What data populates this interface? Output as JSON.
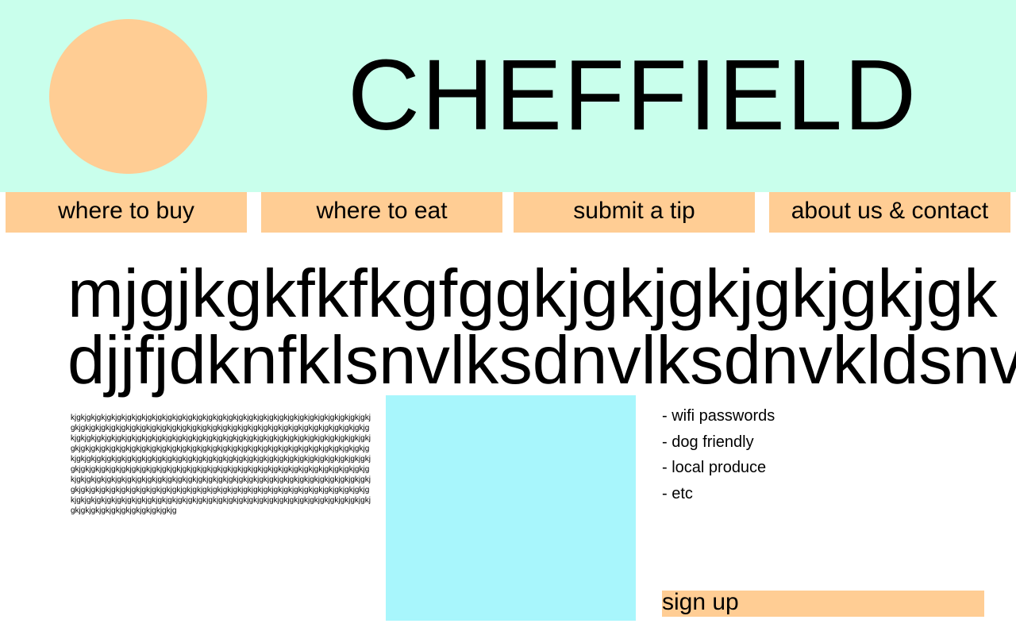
{
  "colors": {
    "header_bg": "#c9ffec",
    "accent": "#ffcd94",
    "image_placeholder": "#a8f6fc",
    "text": "#000000"
  },
  "header": {
    "title": "CHEFFIELD"
  },
  "nav": [
    {
      "label": "where to buy"
    },
    {
      "label": "where to eat"
    },
    {
      "label": "submit a tip"
    },
    {
      "label": "about us & contact"
    }
  ],
  "main": {
    "headline_line1": "mjgjkgkfkfkgfggkjgkjgkjgkjgkjgk",
    "headline_line2": "djjfjdknfklsnvlksdnvlksdnvkldsnv",
    "body_text": "kjgkjgkjgkjgkjgkjgkjgkjgkjgkjgkjgkjgkjgkjgkjgkjgkjgkjgkjgkjgkjgkjgkjgkjgkjgkjgkjgkjgkjgkjgkjgkjgkjgkjgkjgkjgkjgkjgkjgkjgkjgkjgkjgkjgkjgkjgkjgkjgkjgkjgkjgkjgkjgkjgkjgkjgkjgkjgkjgkjgkjgkjgkjgkjgkjgkjgkjgkjgkjgkjgkjgkjgkjgkjgkjgkjgkjgkjgkjgkjgkjgkjgkjgkjgkjgkjgkjgkjgkjgkjgkjgkjgkjgkjgkjgkjgkjgkjgkjgkjgkjgkjgkjgkjgkjgkjgkjgkjgkjgkjgkjgkjgkjgkjgkjgkjgkjgkjgkjgkjgkjgkjgkjgkjgkjgkjgkjgkjgkjgkjgkjgkjgkjgkjgkjgkjgkjgkjgkjgkjgkjgkjgkjgkjgkjgkjgkjgkjgkjgkjgkjgkjgkjgkjgkjgkjgkjgkjgkjgkjgkjgkjgkjgkjgkjgkjgkjgkjgkjgkjgkjgkjgkjgkjgkjgkjgkjgkjgkjgkjgkjgkjgkjgkjgkjgkjgkjgkjgkjgkjgkjgkjgkjgkjgkjgkjgkjgkjgkjgkjgkjgkjgkjgkjgkjgkjgkjgkjgkjgkjgkjgkjgkjgkjgkjgkjgkjgkjgkjgkjgkjgkjgkjgkjgkjgkjgkjgkjgkjgkjgkjgkjgkjgkjgkjgkjgkjgkjgkjgkjgkjgkjgkjgkjgkjgkjgkjgkjgkjgkjgkjgkjgkjgkjgkjgkjgkjgkjgkjgkjgkjgkjgkjgkjgkjgkjgkjgkjgkjgkjgkjgkjgkjgkjgkjgkjg",
    "features": [
      "- wifi passwords",
      "- dog friendly",
      "- local produce",
      "- etc"
    ],
    "signup_label": "sign up"
  }
}
